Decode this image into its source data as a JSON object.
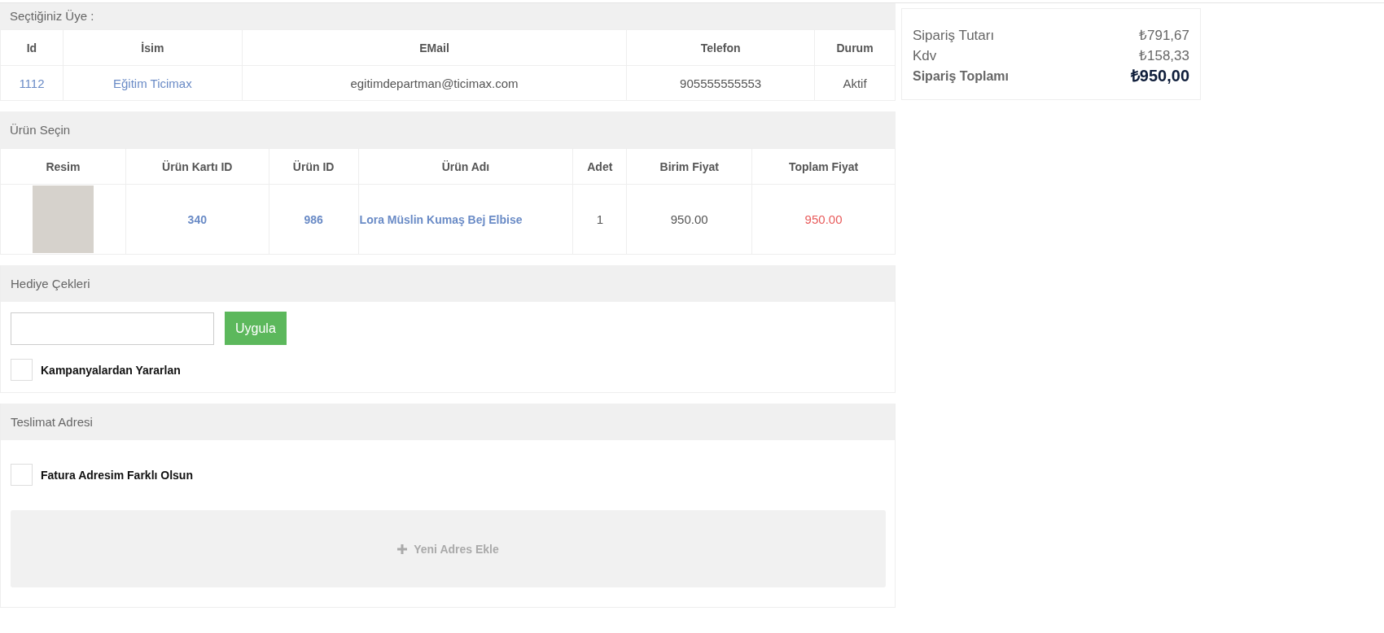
{
  "member": {
    "title": "Seçtiğiniz Üye :",
    "columns": [
      "Id",
      "İsim",
      "EMail",
      "Telefon",
      "Durum"
    ],
    "row": {
      "id": "1112",
      "name": "Eğitim Ticimax",
      "email": "egitimdepartman@ticimax.com",
      "phone": "905555555553",
      "status": "Aktif"
    }
  },
  "products": {
    "title": "Ürün Seçin",
    "columns": [
      "Resim",
      "Ürün Kartı ID",
      "Ürün ID",
      "Ürün Adı",
      "Adet",
      "Birim Fiyat",
      "Toplam Fiyat"
    ],
    "rows": [
      {
        "card_id": "340",
        "product_id": "986",
        "name": "Lora Müslin Kumaş Bej Elbise",
        "quantity": "1",
        "unit_price": "950.00",
        "total_price": "950.00"
      }
    ]
  },
  "gift": {
    "title": "Hediye Çekleri",
    "apply_button": "Uygula",
    "campaign": {
      "label": "Kampanyalardan Yararlan",
      "checked": false
    }
  },
  "delivery": {
    "title": "Teslimat Adresi",
    "different_invoice": {
      "label": "Fatura Adresim Farklı Olsun",
      "checked": false
    },
    "add_button": "Yeni Adres Ekle"
  },
  "summary": {
    "lines": [
      {
        "label": "Sipariş Tutarı",
        "value": "₺791,67",
        "kind": "normal"
      },
      {
        "label": "Kdv",
        "value": "₺158,33",
        "kind": "normal"
      },
      {
        "label": "Sipariş Toplamı",
        "value": "₺950,00",
        "kind": "total"
      }
    ]
  }
}
